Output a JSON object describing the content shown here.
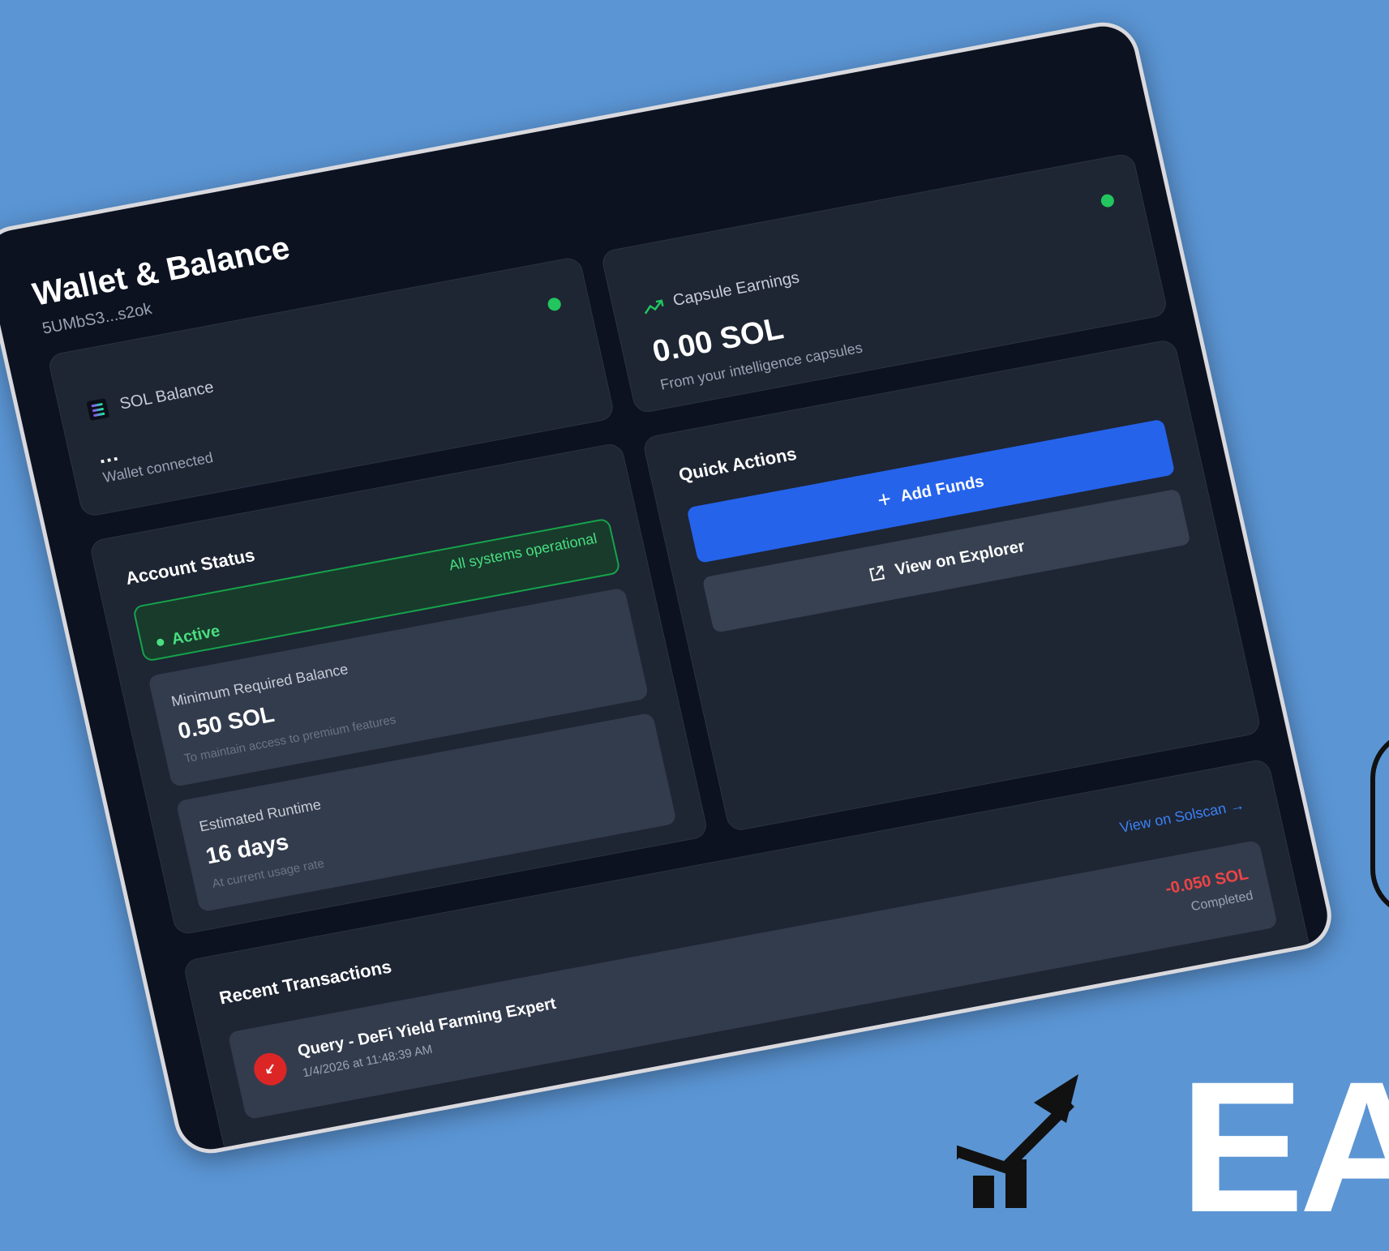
{
  "header": {
    "title": "Wallet & Balance",
    "address": "5UMbS3...s2ok"
  },
  "sol_balance": {
    "label": "SOL Balance",
    "value": "...",
    "status": "Wallet connected"
  },
  "capsule_earnings": {
    "label": "Capsule Earnings",
    "value": "0.00 SOL",
    "subtitle": "From your intelligence capsules"
  },
  "account_status": {
    "title": "Account Status",
    "status": "Active",
    "note": "All systems operational",
    "min_balance": {
      "label": "Minimum Required Balance",
      "value": "0.50 SOL",
      "subtitle": "To maintain access to premium features"
    },
    "runtime": {
      "label": "Estimated Runtime",
      "value": "16 days",
      "subtitle": "At current usage rate"
    }
  },
  "quick_actions": {
    "title": "Quick Actions",
    "add_funds": "Add Funds",
    "view_explorer": "View on Explorer"
  },
  "transactions": {
    "title": "Recent Transactions",
    "link": "View on Solscan →",
    "items": [
      {
        "title": "Query - DeFi Yield Farming Expert",
        "time": "1/4/2026 at 11:48:39 AM",
        "amount": "-0.050 SOL",
        "status": "Completed"
      }
    ]
  },
  "colors": {
    "background": "#5b95d4",
    "panel": "#0c1220",
    "card": "#1e2533",
    "accent": "#2563eb",
    "success": "#22c55e",
    "danger": "#ef4444"
  },
  "icons": [
    "solana-logo-icon",
    "trending-up-icon",
    "plus-icon",
    "external-link-icon",
    "arrow-down-left-icon",
    "status-dot-icon"
  ],
  "background_brand": {
    "text": "EA"
  }
}
